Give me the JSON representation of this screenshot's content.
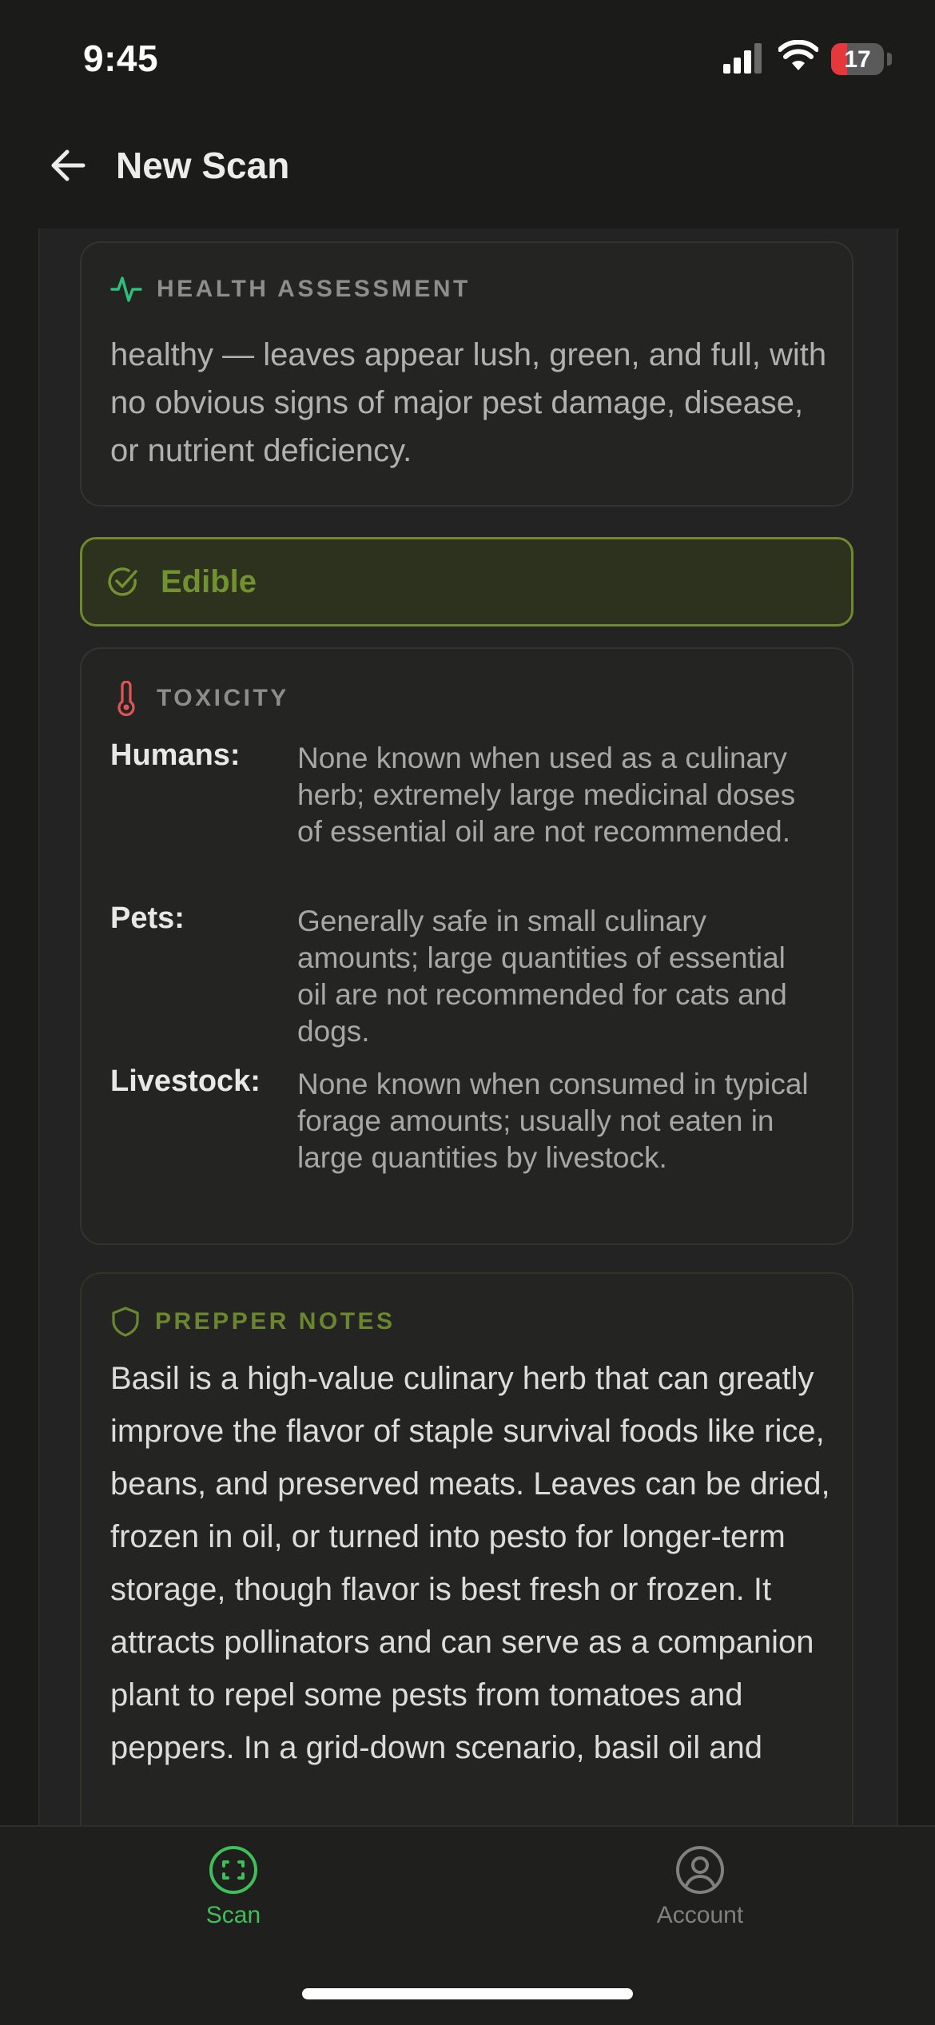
{
  "status_bar": {
    "time": "9:45",
    "battery": "17"
  },
  "nav": {
    "title": "New Scan"
  },
  "health": {
    "label": "HEALTH ASSESSMENT",
    "text": "healthy — leaves appear lush, green, and full, with no obvious signs of major pest damage, disease, or nutrient deficiency."
  },
  "edibility": {
    "label": "Edible"
  },
  "toxicity": {
    "label": "TOXICITY",
    "rows": [
      {
        "key": "Humans:",
        "value": "None known when used as a culinary herb; extremely large medicinal doses of essential oil are not recommended."
      },
      {
        "key": "Pets:",
        "value": "Generally safe in small culinary amounts; large quantities of essential oil are not recommended for cats and dogs."
      },
      {
        "key": "Livestock:",
        "value": "None known when consumed in typical forage amounts; usually not eaten in large quantities by livestock."
      }
    ]
  },
  "prepper": {
    "label": "PREPPER NOTES",
    "text": "Basil is a high-value culinary herb that can greatly improve the flavor of staple survival foods like rice, beans, and preserved meats. Leaves can be dried, frozen in oil, or turned into pesto for longer-term storage, though flavor is best fresh or frozen. It attracts pollinators and can serve as a companion plant to repel some pests from tomatoes and peppers. In a grid-down scenario, basil oil and"
  },
  "tabs": [
    {
      "label": "Scan",
      "icon": "scan-icon",
      "active": true
    },
    {
      "label": "Account",
      "icon": "account-icon",
      "active": false
    }
  ],
  "colors": {
    "accent_green": "#3fbf5a",
    "edible_olive": "#72912f",
    "toxicity_red": "#e25555",
    "health_teal": "#2fbf7a"
  }
}
